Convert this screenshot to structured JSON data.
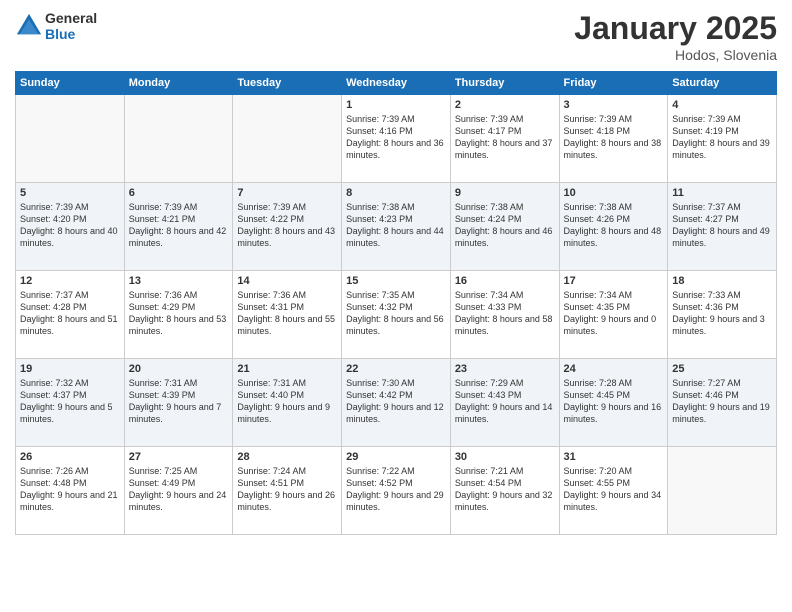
{
  "header": {
    "logo_line1": "General",
    "logo_line2": "Blue",
    "month": "January 2025",
    "location": "Hodos, Slovenia"
  },
  "weekdays": [
    "Sunday",
    "Monday",
    "Tuesday",
    "Wednesday",
    "Thursday",
    "Friday",
    "Saturday"
  ],
  "weeks": [
    [
      {
        "day": "",
        "info": ""
      },
      {
        "day": "",
        "info": ""
      },
      {
        "day": "",
        "info": ""
      },
      {
        "day": "1",
        "info": "Sunrise: 7:39 AM\nSunset: 4:16 PM\nDaylight: 8 hours and 36 minutes."
      },
      {
        "day": "2",
        "info": "Sunrise: 7:39 AM\nSunset: 4:17 PM\nDaylight: 8 hours and 37 minutes."
      },
      {
        "day": "3",
        "info": "Sunrise: 7:39 AM\nSunset: 4:18 PM\nDaylight: 8 hours and 38 minutes."
      },
      {
        "day": "4",
        "info": "Sunrise: 7:39 AM\nSunset: 4:19 PM\nDaylight: 8 hours and 39 minutes."
      }
    ],
    [
      {
        "day": "5",
        "info": "Sunrise: 7:39 AM\nSunset: 4:20 PM\nDaylight: 8 hours and 40 minutes."
      },
      {
        "day": "6",
        "info": "Sunrise: 7:39 AM\nSunset: 4:21 PM\nDaylight: 8 hours and 42 minutes."
      },
      {
        "day": "7",
        "info": "Sunrise: 7:39 AM\nSunset: 4:22 PM\nDaylight: 8 hours and 43 minutes."
      },
      {
        "day": "8",
        "info": "Sunrise: 7:38 AM\nSunset: 4:23 PM\nDaylight: 8 hours and 44 minutes."
      },
      {
        "day": "9",
        "info": "Sunrise: 7:38 AM\nSunset: 4:24 PM\nDaylight: 8 hours and 46 minutes."
      },
      {
        "day": "10",
        "info": "Sunrise: 7:38 AM\nSunset: 4:26 PM\nDaylight: 8 hours and 48 minutes."
      },
      {
        "day": "11",
        "info": "Sunrise: 7:37 AM\nSunset: 4:27 PM\nDaylight: 8 hours and 49 minutes."
      }
    ],
    [
      {
        "day": "12",
        "info": "Sunrise: 7:37 AM\nSunset: 4:28 PM\nDaylight: 8 hours and 51 minutes."
      },
      {
        "day": "13",
        "info": "Sunrise: 7:36 AM\nSunset: 4:29 PM\nDaylight: 8 hours and 53 minutes."
      },
      {
        "day": "14",
        "info": "Sunrise: 7:36 AM\nSunset: 4:31 PM\nDaylight: 8 hours and 55 minutes."
      },
      {
        "day": "15",
        "info": "Sunrise: 7:35 AM\nSunset: 4:32 PM\nDaylight: 8 hours and 56 minutes."
      },
      {
        "day": "16",
        "info": "Sunrise: 7:34 AM\nSunset: 4:33 PM\nDaylight: 8 hours and 58 minutes."
      },
      {
        "day": "17",
        "info": "Sunrise: 7:34 AM\nSunset: 4:35 PM\nDaylight: 9 hours and 0 minutes."
      },
      {
        "day": "18",
        "info": "Sunrise: 7:33 AM\nSunset: 4:36 PM\nDaylight: 9 hours and 3 minutes."
      }
    ],
    [
      {
        "day": "19",
        "info": "Sunrise: 7:32 AM\nSunset: 4:37 PM\nDaylight: 9 hours and 5 minutes."
      },
      {
        "day": "20",
        "info": "Sunrise: 7:31 AM\nSunset: 4:39 PM\nDaylight: 9 hours and 7 minutes."
      },
      {
        "day": "21",
        "info": "Sunrise: 7:31 AM\nSunset: 4:40 PM\nDaylight: 9 hours and 9 minutes."
      },
      {
        "day": "22",
        "info": "Sunrise: 7:30 AM\nSunset: 4:42 PM\nDaylight: 9 hours and 12 minutes."
      },
      {
        "day": "23",
        "info": "Sunrise: 7:29 AM\nSunset: 4:43 PM\nDaylight: 9 hours and 14 minutes."
      },
      {
        "day": "24",
        "info": "Sunrise: 7:28 AM\nSunset: 4:45 PM\nDaylight: 9 hours and 16 minutes."
      },
      {
        "day": "25",
        "info": "Sunrise: 7:27 AM\nSunset: 4:46 PM\nDaylight: 9 hours and 19 minutes."
      }
    ],
    [
      {
        "day": "26",
        "info": "Sunrise: 7:26 AM\nSunset: 4:48 PM\nDaylight: 9 hours and 21 minutes."
      },
      {
        "day": "27",
        "info": "Sunrise: 7:25 AM\nSunset: 4:49 PM\nDaylight: 9 hours and 24 minutes."
      },
      {
        "day": "28",
        "info": "Sunrise: 7:24 AM\nSunset: 4:51 PM\nDaylight: 9 hours and 26 minutes."
      },
      {
        "day": "29",
        "info": "Sunrise: 7:22 AM\nSunset: 4:52 PM\nDaylight: 9 hours and 29 minutes."
      },
      {
        "day": "30",
        "info": "Sunrise: 7:21 AM\nSunset: 4:54 PM\nDaylight: 9 hours and 32 minutes."
      },
      {
        "day": "31",
        "info": "Sunrise: 7:20 AM\nSunset: 4:55 PM\nDaylight: 9 hours and 34 minutes."
      },
      {
        "day": "",
        "info": ""
      }
    ]
  ]
}
